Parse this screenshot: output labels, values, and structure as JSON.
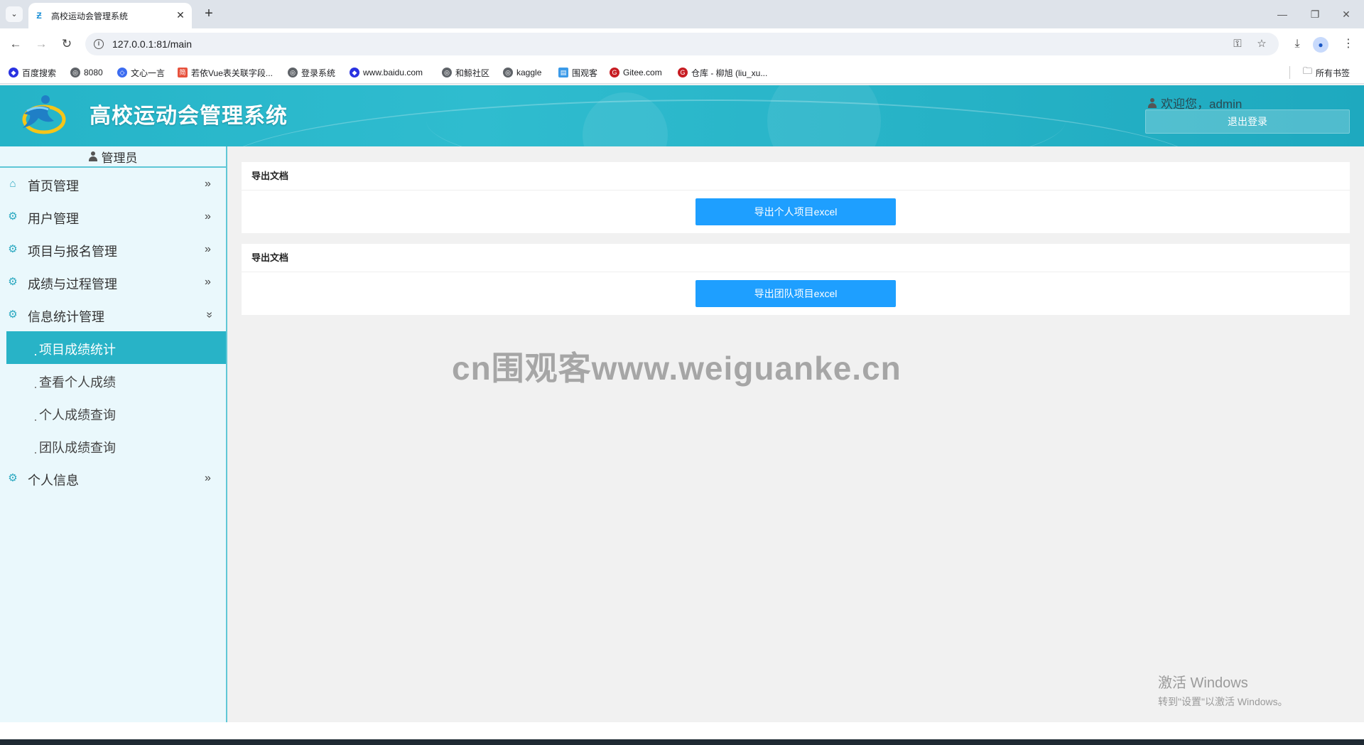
{
  "browser": {
    "tab_title": "高校运动会管理系统",
    "url": "127.0.0.1:81/main",
    "bookmarks": [
      {
        "label": "百度搜索",
        "icon": "baidu-icon",
        "color": "#2932e1"
      },
      {
        "label": "8080",
        "icon": "globe-icon",
        "color": "#5f6368"
      },
      {
        "label": "文心一言",
        "icon": "wenxin-icon",
        "color": "#3c6cf0"
      },
      {
        "label": "若依Vue表关联字段...",
        "icon": "jianshu-icon",
        "color": "#e7533e"
      },
      {
        "label": "登录系统",
        "icon": "globe-icon",
        "color": "#5f6368"
      },
      {
        "label": "www.baidu.com",
        "icon": "baidu-icon",
        "color": "#2932e1"
      },
      {
        "label": "和鲸社区",
        "icon": "globe-icon",
        "color": "#5f6368"
      },
      {
        "label": "kaggle",
        "icon": "globe-icon",
        "color": "#5f6368"
      },
      {
        "label": "围观客",
        "icon": "weiguanke-icon",
        "color": "#3b9ae8"
      },
      {
        "label": "Gitee.com",
        "icon": "gitee-icon",
        "color": "#c71d23"
      },
      {
        "label": "仓库 - 柳旭 (liu_xu...",
        "icon": "gitee-icon",
        "color": "#c71d23"
      }
    ],
    "all_bookmarks": "所有书签"
  },
  "header": {
    "title": "高校运动会管理系统",
    "welcome": "欢迎您，admin",
    "logout": "退出登录"
  },
  "sidebar": {
    "role": "管理员",
    "menu": [
      {
        "label": "首页管理",
        "icon": "home-icon",
        "expanded": false
      },
      {
        "label": "用户管理",
        "icon": "gear-icon",
        "expanded": false
      },
      {
        "label": "项目与报名管理",
        "icon": "gear-icon",
        "expanded": false
      },
      {
        "label": "成绩与过程管理",
        "icon": "gear-icon",
        "expanded": false
      },
      {
        "label": "信息统计管理",
        "icon": "gear-icon",
        "expanded": true,
        "children": [
          {
            "label": "项目成绩统计",
            "active": true
          },
          {
            "label": "查看个人成绩",
            "active": false
          },
          {
            "label": "个人成绩查询",
            "active": false
          },
          {
            "label": "团队成绩查询",
            "active": false
          }
        ]
      },
      {
        "label": "个人信息",
        "icon": "gear-icon",
        "expanded": false
      }
    ]
  },
  "main": {
    "cards": [
      {
        "title": "导出文档",
        "button": "导出个人项目excel"
      },
      {
        "title": "导出文档",
        "button": "导出团队项目excel"
      }
    ]
  },
  "watermark": "cn围观客www.weiguanke.cn",
  "os": {
    "activate_title": "激活 Windows",
    "activate_sub": "转到\"设置\"以激活 Windows。"
  },
  "colors": {
    "header": "#2fbccf",
    "accent": "#28b3c7",
    "button": "#1e9fff",
    "sidebar_bg": "#eaf8fc"
  }
}
